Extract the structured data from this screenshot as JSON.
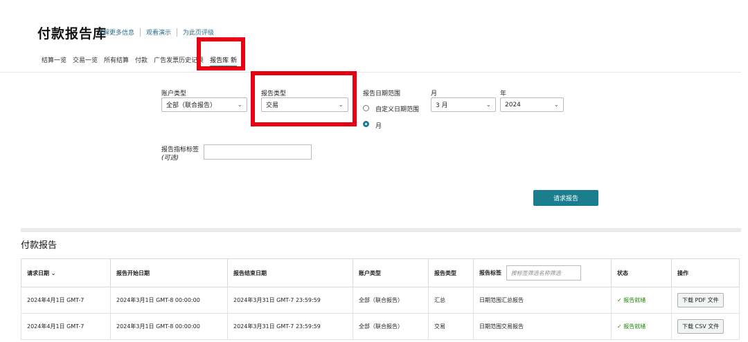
{
  "header": {
    "title": "付款报告库",
    "links": [
      "了解更多信息",
      "观看演示",
      "为此页评级"
    ]
  },
  "tabs": [
    "结算一览",
    "交易一览",
    "所有结算",
    "付款",
    "广告发票历史记录",
    "报告库 新"
  ],
  "filters": {
    "account_type_label": "账户类型",
    "account_type_value": "全部（联合报告）",
    "report_type_label": "报告类型",
    "report_type_value": "交易",
    "date_range_label": "报告日期范围",
    "radio_custom": "自定义日期范围",
    "radio_month": "月",
    "month_label": "月",
    "month_value": "3 月",
    "year_label": "年",
    "year_value": "2024",
    "report_tag_label": "报告指标标签",
    "report_tag_optional": "(可选)",
    "request_button": "请求报告"
  },
  "results": {
    "title": "付款报告",
    "search_placeholder": "按标签筛选名称筛选",
    "columns": [
      "请求日期",
      "报告开始日期",
      "报告结束日期",
      "账户类型",
      "报告类型",
      "报告标签",
      "状态",
      "操作"
    ],
    "rows": [
      {
        "request_date": "2024年4月1日 GMT-7",
        "start": "2024年3月1日 GMT-8 00:00:00",
        "end": "2024年3月31日 GMT-7 23:59:59",
        "account": "全部（联合报告）",
        "type": "汇总",
        "tag": "日期范围汇总报告",
        "status": "✓ 报告就绪",
        "action": "下载 PDF 文件"
      },
      {
        "request_date": "2024年4月1日 GMT-7",
        "start": "2024年3月1日 GMT-8 00:00:00",
        "end": "2024年3月31日 GMT-7 23:59:59",
        "account": "全部（联合报告）",
        "type": "交易",
        "tag": "日期范围交易报告",
        "status": "✓ 报告就绪",
        "action": "下载 CSV 文件"
      }
    ]
  },
  "colors": {
    "accent": "#1b7e8f",
    "highlight": "#e60012",
    "status_ok": "#1d8102"
  }
}
